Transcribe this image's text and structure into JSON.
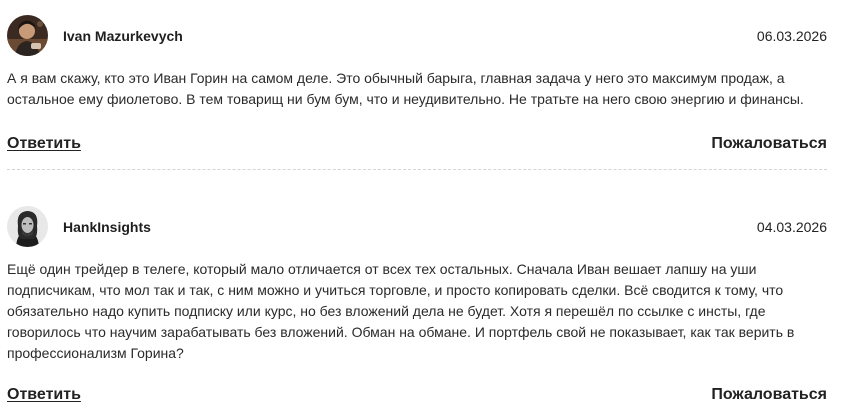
{
  "comments": [
    {
      "author": "Ivan Mazurkevych",
      "date": "06.03.2026",
      "text": "А я вам скажу, кто это Иван Горин на самом деле. Это обычный барыга, главная задача у него это максимум продаж, а остальное ему фиолетово. В тем товарищ ни бум бум, что и неудивительно. Не тратьте на него свою энергию и финансы.",
      "reply_label": "Ответить",
      "report_label": "Пожаловаться"
    },
    {
      "author": "HankInsights",
      "date": "04.03.2026",
      "text": "Ещё один трейдер в телеге, который мало отличается от всех тех остальных. Сначала Иван вешает лапшу на уши подписчикам, что мол так и так, с ним можно и учиться торговле, и просто копировать сделки. Всё сводится к тому, что обязательно надо купить подписку или курс, но без вложений дела не будет. Хотя я перешёл по ссылке с инсты, где говорилось что научим зарабатывать без вложений. Обман на обмане. И портфель свой не показывает, как так верить в профессионализм Горина?",
      "reply_label": "Ответить",
      "report_label": "Пожаловаться"
    }
  ]
}
